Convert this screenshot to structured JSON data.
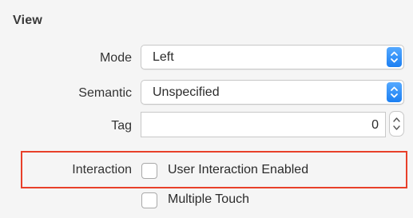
{
  "section": {
    "title": "View"
  },
  "mode": {
    "label": "Mode",
    "value": "Left"
  },
  "semantic": {
    "label": "Semantic",
    "value": "Unspecified"
  },
  "tag": {
    "label": "Tag",
    "value": "0"
  },
  "interaction": {
    "label": "Interaction",
    "user_interaction_label": "User Interaction Enabled",
    "user_interaction_checked": false,
    "multiple_touch_label": "Multiple Touch",
    "multiple_touch_checked": false
  },
  "colors": {
    "accent": "#1b7ff2",
    "highlight_border": "#e8402a",
    "panel_background": "#f5f5f5"
  },
  "icons": {
    "popup_stepper": "chevron-up-down-icon",
    "number_stepper": "chevron-up-down-icon"
  }
}
